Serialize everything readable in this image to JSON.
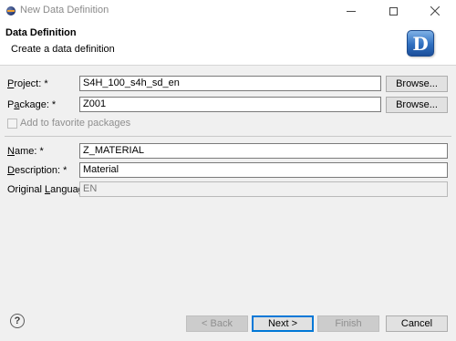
{
  "window": {
    "title": "New Data Definition",
    "icon": "eclipse-icon"
  },
  "header": {
    "title": "Data Definition",
    "subtitle": "Create a data definition",
    "badge_letter": "D"
  },
  "form": {
    "project": {
      "label_pre": "",
      "label_u": "P",
      "label_post": "roject: *",
      "value": "S4H_100_s4h_sd_en",
      "browse": "Browse..."
    },
    "package": {
      "label_pre": "P",
      "label_u": "a",
      "label_post": "ckage: *",
      "value": "Z001",
      "browse": "Browse..."
    },
    "favorite": {
      "label": "Add to favorite packages",
      "checked": false,
      "enabled": false
    },
    "name": {
      "label_pre": "",
      "label_u": "N",
      "label_post": "ame: *",
      "value": "Z_MATERIAL"
    },
    "description": {
      "label_pre": "",
      "label_u": "D",
      "label_post": "escription: *",
      "value": "Material"
    },
    "language": {
      "label_pre": "Original ",
      "label_u": "L",
      "label_post": "anguage:",
      "value": "EN"
    }
  },
  "footer": {
    "help": "?",
    "back": "< Back",
    "next": "Next >",
    "finish": "Finish",
    "cancel": "Cancel"
  }
}
